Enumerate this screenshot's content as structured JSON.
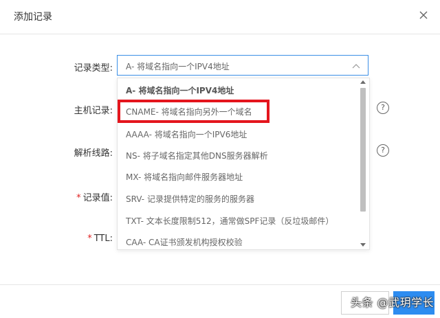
{
  "dialog": {
    "title": "添加记录",
    "close_icon": "close-icon"
  },
  "form": {
    "record_type_label": "记录类型:",
    "host_label": "主机记录:",
    "line_label": "解析线路:",
    "value_label": "记录值:",
    "ttl_label": "TTL:",
    "required_mark": "*",
    "help_glyph": "?"
  },
  "select": {
    "value": "A- 将域名指向一个IPV4地址",
    "chevron_icon": "chevron-up-icon"
  },
  "options": [
    {
      "label": "A- 将域名指向一个IPV4地址",
      "selected": true
    },
    {
      "label": "CNAME- 将域名指向另外一个域名",
      "selected": false,
      "highlighted": true
    },
    {
      "label": "AAAA- 将域名指向一个IPV6地址",
      "selected": false
    },
    {
      "label": "NS- 将子域名指定其他DNS服务器解析",
      "selected": false
    },
    {
      "label": "MX- 将域名指向邮件服务器地址",
      "selected": false
    },
    {
      "label": "SRV- 记录提供特定的服务的服务器",
      "selected": false
    },
    {
      "label": "TXT- 文本长度限制512，通常做SPF记录（反垃圾邮件）",
      "selected": false
    },
    {
      "label": "CAA- CA证书颁发机构授权校验",
      "selected": false
    }
  ],
  "colors": {
    "accent": "#2d8cf0",
    "highlight": "#e4151d",
    "required": "#e02020"
  },
  "watermark": "头条 @武玥学长"
}
